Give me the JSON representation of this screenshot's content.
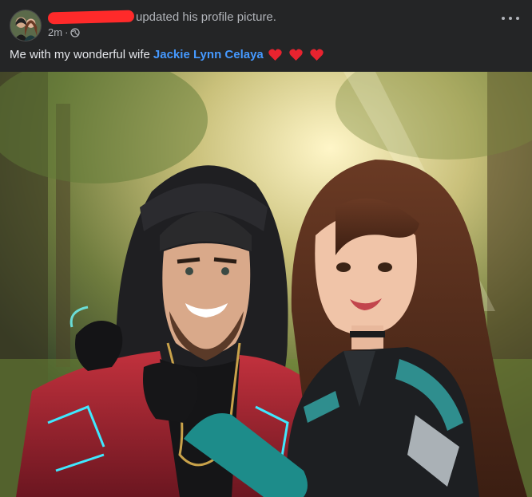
{
  "post": {
    "author_redacted": true,
    "action_text": "updated his profile picture.",
    "timestamp": "2m",
    "separator": "·",
    "privacy_icon": "globe-icon",
    "more_icon": "ellipsis-icon",
    "caption": {
      "text": "Me with my wonderful wife",
      "mention": "Jackie Lynn Celaya",
      "emoji": [
        "❤️",
        "❤️",
        "❤️"
      ]
    },
    "photo": {
      "subject": "profile-picture"
    }
  },
  "colors": {
    "background": "#242526",
    "text_primary": "#e4e6eb",
    "text_secondary": "#b0b3b8",
    "mention": "#4599ff",
    "redaction": "#ff2a2a",
    "heart": "#e8232f"
  }
}
